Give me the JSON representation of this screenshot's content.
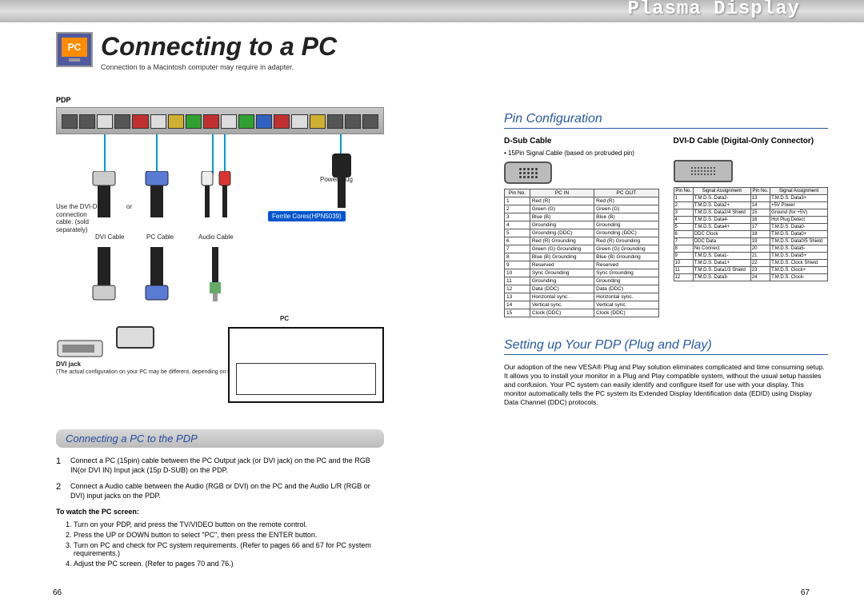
{
  "brand": "Plasma Display",
  "header": {
    "icon_text": "PC",
    "title": "Connecting to a PC",
    "subtitle": "Connection to a Macintosh computer may require in adapter."
  },
  "diagram": {
    "pdp_label": "PDP",
    "use_dvi_note": "Use the DVI-D connection cable. (sold separately)",
    "or_label": "or",
    "dvi_cable": "DVI Cable",
    "pc_cable": "PC Cable",
    "audio_cable": "Audio Cable",
    "power_plug": "Power Plug",
    "ferrite": "Ferrite Cores(HPN5039)",
    "pc_label": "PC",
    "dvi_jack_title": "DVI jack",
    "dvi_jack_note": "(The actual configuration on your PC may be different, depending on the model.)"
  },
  "sectionbar": "Connecting a PC to the PDP",
  "steps": {
    "s1": "Connect a PC (15pin) cable between the PC Output jack (or DVI jack) on the PC and the RGB IN(or DVI IN) Input jack (15p D-SUB) on the PDP.",
    "s2": "Connect a Audio cable between the Audio (RGB or DVI) on the PC and the Audio L/R (RGB or DVI) input jacks on the PDP."
  },
  "watch": {
    "heading": "To watch the PC screen:",
    "i1": "Turn on your PDP, and press the TV/VIDEO button on the remote control.",
    "i2": "Press the UP or DOWN button to select \"PC\", then press the ENTER button.",
    "i3": "Turn on PC and check for PC system requirements. (Refer to pages 66 and 67 for PC system requirements.)",
    "i4": "Adjust the PC screen. (Refer to pages 70 and 76.)"
  },
  "pin": {
    "title": "Pin Configuration",
    "dsub_head": "D-Sub Cable",
    "dsub_bullet": "• 15Pin Signal Cable (based on protruded pin)",
    "dvi_head": "DVI-D Cable (Digital-Only Connector)",
    "dsub_cols": [
      "Pin No.",
      "PC IN",
      "PC OUT"
    ],
    "dsub_rows": [
      [
        "1",
        "Red (R)",
        "Red (R)"
      ],
      [
        "2",
        "Green (G)",
        "Green (G)"
      ],
      [
        "3",
        "Blue (B)",
        "Blue (B)"
      ],
      [
        "4",
        "Grounding",
        "Grounding"
      ],
      [
        "5",
        "Grounding (DDC)",
        "Grounding (DDC)"
      ],
      [
        "6",
        "Red (R) Grounding",
        "Red (R) Grounding"
      ],
      [
        "7",
        "Green (G) Grounding",
        "Green (G) Grounding"
      ],
      [
        "8",
        "Blue (B) Grounding",
        "Blue (B) Grounding"
      ],
      [
        "9",
        "Reserved",
        "Reserved"
      ],
      [
        "10",
        "Sync Grounding",
        "Sync Grounding"
      ],
      [
        "11",
        "Grounding",
        "Grounding"
      ],
      [
        "12",
        "Data (DDC)",
        "Data (DDC)"
      ],
      [
        "13",
        "Horizontal sync.",
        "Horizontal sync."
      ],
      [
        "14",
        "Vertical sync.",
        "Vertical sync."
      ],
      [
        "15",
        "Clock (DDC)",
        "Clock (DDC)"
      ]
    ],
    "dvi_cols": [
      "Pin No.",
      "Signal Assignment",
      "Pin No.",
      "Signal Assignment"
    ],
    "dvi_rows": [
      [
        "1",
        "T.M.D.S. Data2-",
        "13",
        "T.M.D.S. Data3+"
      ],
      [
        "2",
        "T.M.D.S. Data2+",
        "14",
        "+5V Power"
      ],
      [
        "3",
        "T.M.D.S. Data2/4 Shield",
        "15",
        "Ground (for +5V)"
      ],
      [
        "4",
        "T.M.D.S. Data4-",
        "16",
        "Hot Plug Detect"
      ],
      [
        "5",
        "T.M.D.S. Data4+",
        "17",
        "T.M.D.S. Data0-"
      ],
      [
        "6",
        "DDC Clock",
        "18",
        "T.M.D.S. Data0+"
      ],
      [
        "7",
        "DDC Data",
        "19",
        "T.M.D.S. Data0/5 Shield"
      ],
      [
        "8",
        "No Connect",
        "20",
        "T.M.D.S. Data5-"
      ],
      [
        "9",
        "T.M.D.S. Data1-",
        "21",
        "T.M.D.S. Data5+"
      ],
      [
        "10",
        "T.M.D.S. Data1+",
        "22",
        "T.M.D.S. Clock Shield"
      ],
      [
        "11",
        "T.M.D.S. Data1/3 Shield",
        "23",
        "T.M.D.S. Clock+"
      ],
      [
        "12",
        "T.M.D.S. Data3-",
        "24",
        "T.M.D.S. Clock-"
      ]
    ]
  },
  "setup": {
    "title": "Setting up Your PDP (Plug and Play)",
    "body": "Our adoption of the new VESA® Plug and Play solution eliminates complicated and time consuming setup. It allows you to install your monitor in a Plug and Play compatible system, without the usual setup hassles and confusion. Your PC system can easily identify and configure itself for use with your display. This monitor automatically tells the PC system its Extended Display Identification data (EDID) using Display Data Channel (DDC) protocols."
  },
  "pages": {
    "left": "66",
    "right": "67"
  }
}
